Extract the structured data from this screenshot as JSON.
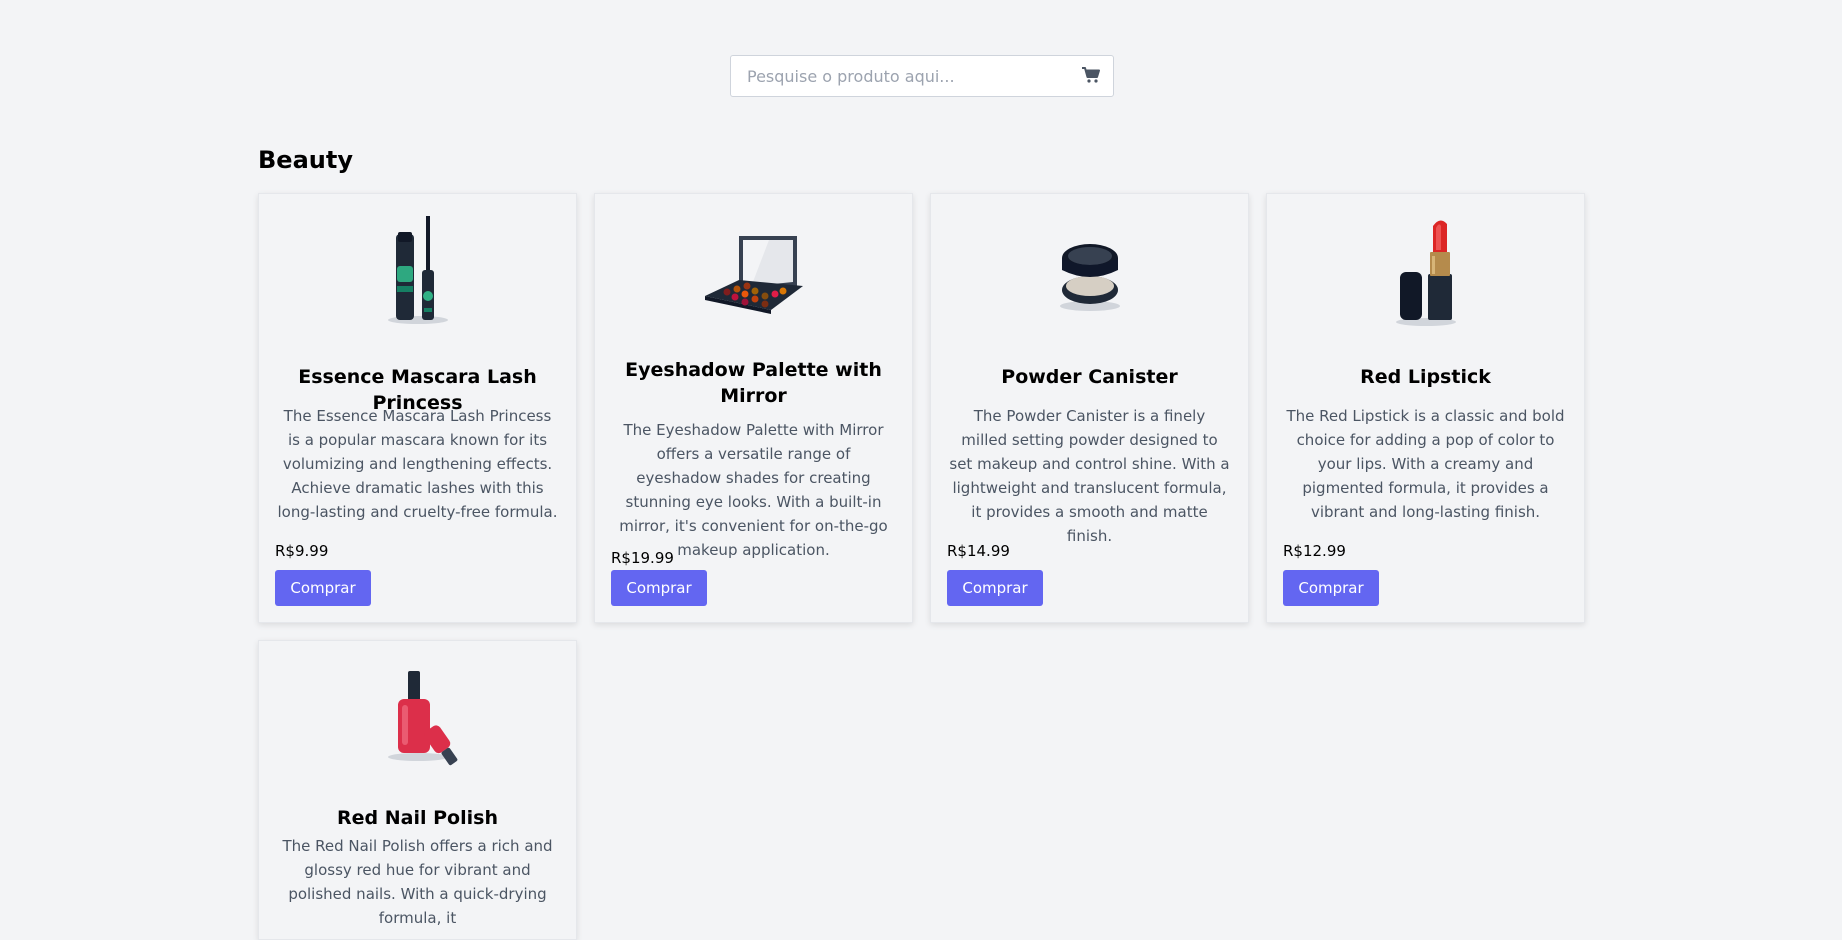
{
  "search": {
    "placeholder": "Pesquise o produto aqui...",
    "icon": "cart-icon"
  },
  "category": {
    "title": "Beauty"
  },
  "products": [
    {
      "title": "Essence Mascara Lash Princess",
      "description": "The Essence Mascara Lash Princess is a popular mascara known for its volumizing and lengthening effects. Achieve dramatic lashes with this long-lasting and cruelty-free formula.",
      "price": "R$9.99",
      "button": "Comprar",
      "image": "mascara-image"
    },
    {
      "title": "Eyeshadow Palette with Mirror",
      "description": "The Eyeshadow Palette with Mirror offers a versatile range of eyeshadow shades for creating stunning eye looks. With a built-in mirror, it's convenient for on-the-go makeup application.",
      "price": "R$19.99",
      "button": "Comprar",
      "image": "eyeshadow-palette-image"
    },
    {
      "title": "Powder Canister",
      "description": "The Powder Canister is a finely milled setting powder designed to set makeup and control shine. With a lightweight and translucent formula, it provides a smooth and matte finish.",
      "price": "R$14.99",
      "button": "Comprar",
      "image": "powder-canister-image"
    },
    {
      "title": "Red Lipstick",
      "description": "The Red Lipstick is a classic and bold choice for adding a pop of color to your lips. With a creamy and pigmented formula, it provides a vibrant and long-lasting finish.",
      "price": "R$12.99",
      "button": "Comprar",
      "image": "lipstick-image"
    },
    {
      "title": "Red Nail Polish",
      "description": "The Red Nail Polish offers a rich and glossy red hue for vibrant and polished nails. With a quick-drying formula, it",
      "price": "",
      "button": "",
      "image": "nail-polish-image"
    }
  ],
  "colors": {
    "accent": "#6366f1",
    "background": "#f3f4f6"
  }
}
